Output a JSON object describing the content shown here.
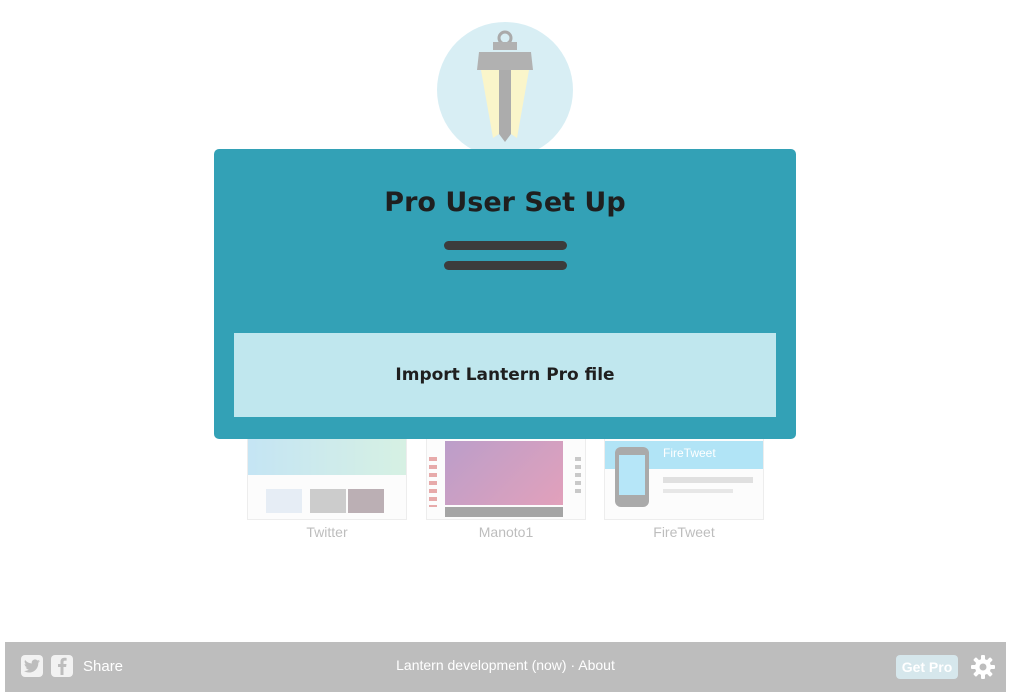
{
  "modal": {
    "title": "Pro User Set Up",
    "menu_icon": "hamburger-icon",
    "import_button_label": "Import Lantern Pro file"
  },
  "background": {
    "logo_icon": "lantern-icon",
    "sites": [
      {
        "label": "Twitter"
      },
      {
        "label": "Manoto1"
      },
      {
        "label": "FireTweet",
        "thumb_title": "FireTweet"
      }
    ]
  },
  "footer": {
    "twitter_icon": "twitter-icon",
    "facebook_icon": "facebook-icon",
    "share_label": "Share",
    "status_text": "Lantern development (now) · About",
    "get_pro_label": "Get Pro",
    "settings_icon": "gear-icon"
  },
  "colors": {
    "modal_bg": "#33a1b6",
    "button_bg": "#c0e7ee",
    "footer_bg": "#bdbdbd"
  }
}
